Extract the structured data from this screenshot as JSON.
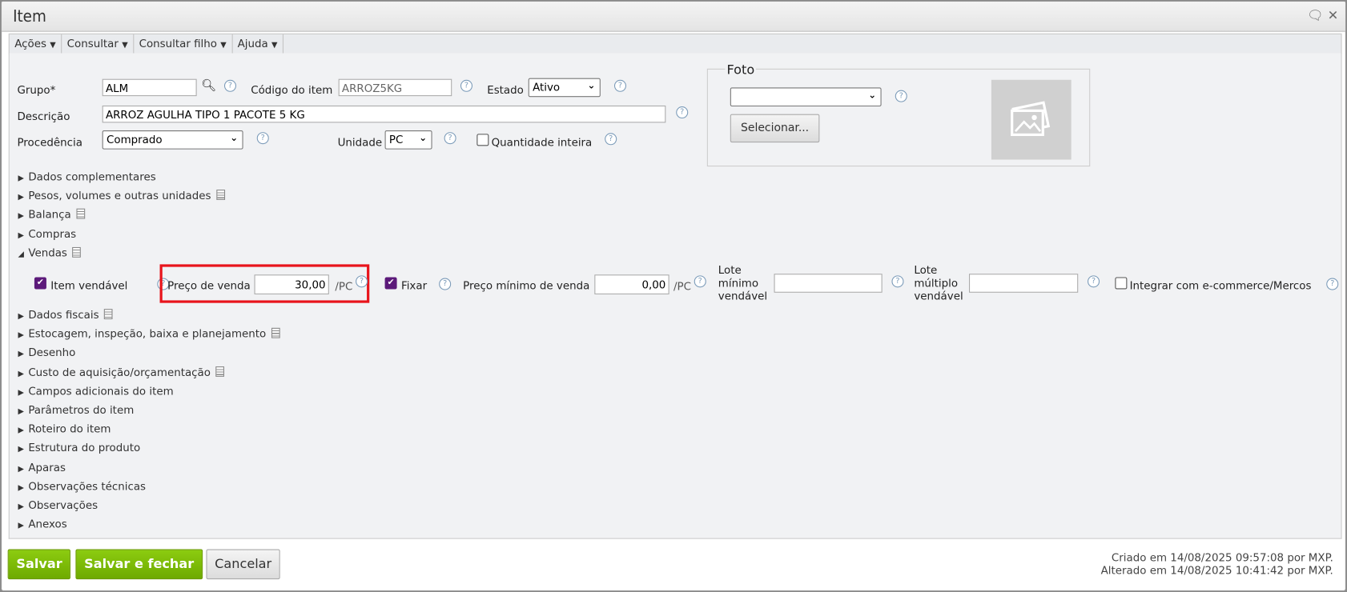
{
  "window": {
    "title": "Item"
  },
  "menu": [
    "Ações",
    "Consultar",
    "Consultar filho",
    "Ajuda"
  ],
  "form": {
    "grupo_label": "Grupo*",
    "grupo_value": "ALM",
    "codigo_label": "Código do item",
    "codigo_value": "ARROZ5KG",
    "estado_label": "Estado",
    "estado_value": "Ativo",
    "descricao_label": "Descrição",
    "descricao_value": "ARROZ AGULHA TIPO 1 PACOTE 5 KG",
    "procedencia_label": "Procedência",
    "procedencia_value": "Comprado",
    "unidade_label": "Unidade",
    "unidade_value": "PC",
    "qtd_inteira_label": "Quantidade inteira"
  },
  "foto": {
    "legend": "Foto",
    "select_value": "",
    "button": "Selecionar..."
  },
  "sections_top": [
    "Dados complementares",
    "Pesos, volumes e outras unidades",
    "Balança",
    "Compras",
    "Vendas"
  ],
  "vendas": {
    "item_vendavel": "Item vendável",
    "preco_label": "Preço de venda",
    "preco_value": "30,00",
    "unit": "/PC",
    "fixar": "Fixar",
    "preco_min_label": "Preço mínimo de venda",
    "preco_min_value": "0,00",
    "lote_min_label": [
      "Lote",
      "mínimo",
      "vendável"
    ],
    "lote_mult_label": [
      "Lote",
      "múltiplo",
      "vendável"
    ],
    "lote_min_value": "",
    "lote_mult_value": "",
    "integrar": "Integrar com e-commerce/Mercos"
  },
  "sections_bottom": [
    "Dados fiscais",
    "Estocagem, inspeção, baixa e planejamento",
    "Desenho",
    "Custo de aquisição/orçamentação",
    "Campos adicionais do item",
    "Parâmetros do item",
    "Roteiro do item",
    "Estrutura do produto",
    "Aparas",
    "Observações técnicas",
    "Observações",
    "Anexos"
  ],
  "footer": {
    "salvar": "Salvar",
    "salvar_fechar": "Salvar e fechar",
    "cancelar": "Cancelar",
    "criado": "Criado em 14/08/2025 09:57:08 por MXP.",
    "alterado": "Alterado em 14/08/2025 10:41:42 por MXP."
  }
}
